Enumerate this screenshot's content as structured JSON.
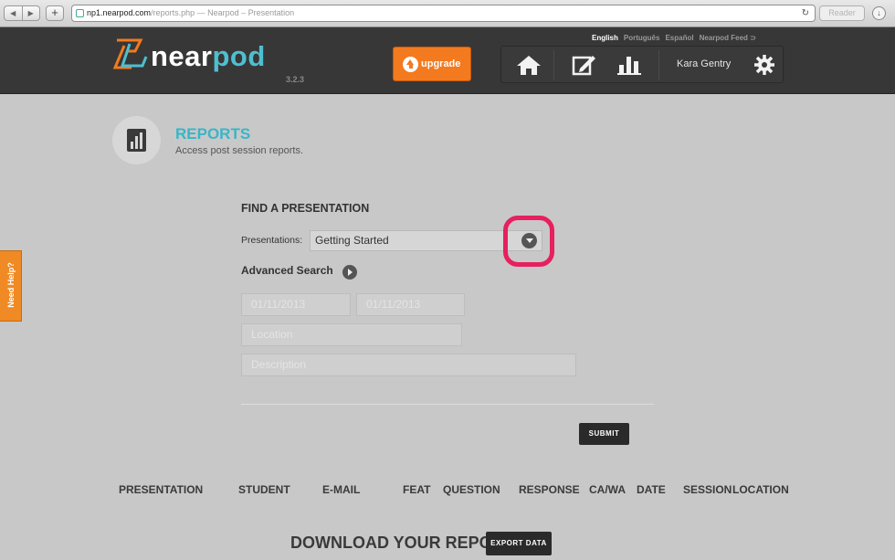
{
  "browser": {
    "url_host": "np1.nearpod.com",
    "url_rest": "/reports.php — Nearpod – Presentation",
    "reader_label": "Reader"
  },
  "header": {
    "logo_near": "near",
    "logo_pod": "pod",
    "version": "3.2.3",
    "languages": [
      "English",
      "Português",
      "Español"
    ],
    "feed_label": "Nearpod Feed",
    "upgrade_label": "upgrade",
    "user_name": "Kara Gentry",
    "nav_icons": [
      "home-icon",
      "edit-icon",
      "reports-icon",
      "settings-icon"
    ]
  },
  "need_help": "Need Help?",
  "reports": {
    "title": "REPORTS",
    "subtitle": "Access post session reports."
  },
  "find": {
    "title": "FIND A PRESENTATION",
    "presentations_label": "Presentations:",
    "selected_presentation": "Getting Started",
    "advanced_search_label": "Advanced Search",
    "date_from": "01/11/2013",
    "date_to": "01/11/2013",
    "location_placeholder": "Location",
    "description_placeholder": "Description",
    "submit_label": "SUBMIT"
  },
  "columns": [
    "PRESENTATION",
    "STUDENT",
    "E-MAIL",
    "FEAT",
    "QUESTION",
    "RESPONSE",
    "CA/WA",
    "DATE",
    "SESSION",
    "LOCATION"
  ],
  "download": {
    "title": "DOWNLOAD YOUR REPORT",
    "export_label": "EXPORT DATA"
  },
  "colors": {
    "accent_orange": "#f37a1f",
    "accent_teal": "#37b6c8",
    "highlight": "#e7205f"
  }
}
